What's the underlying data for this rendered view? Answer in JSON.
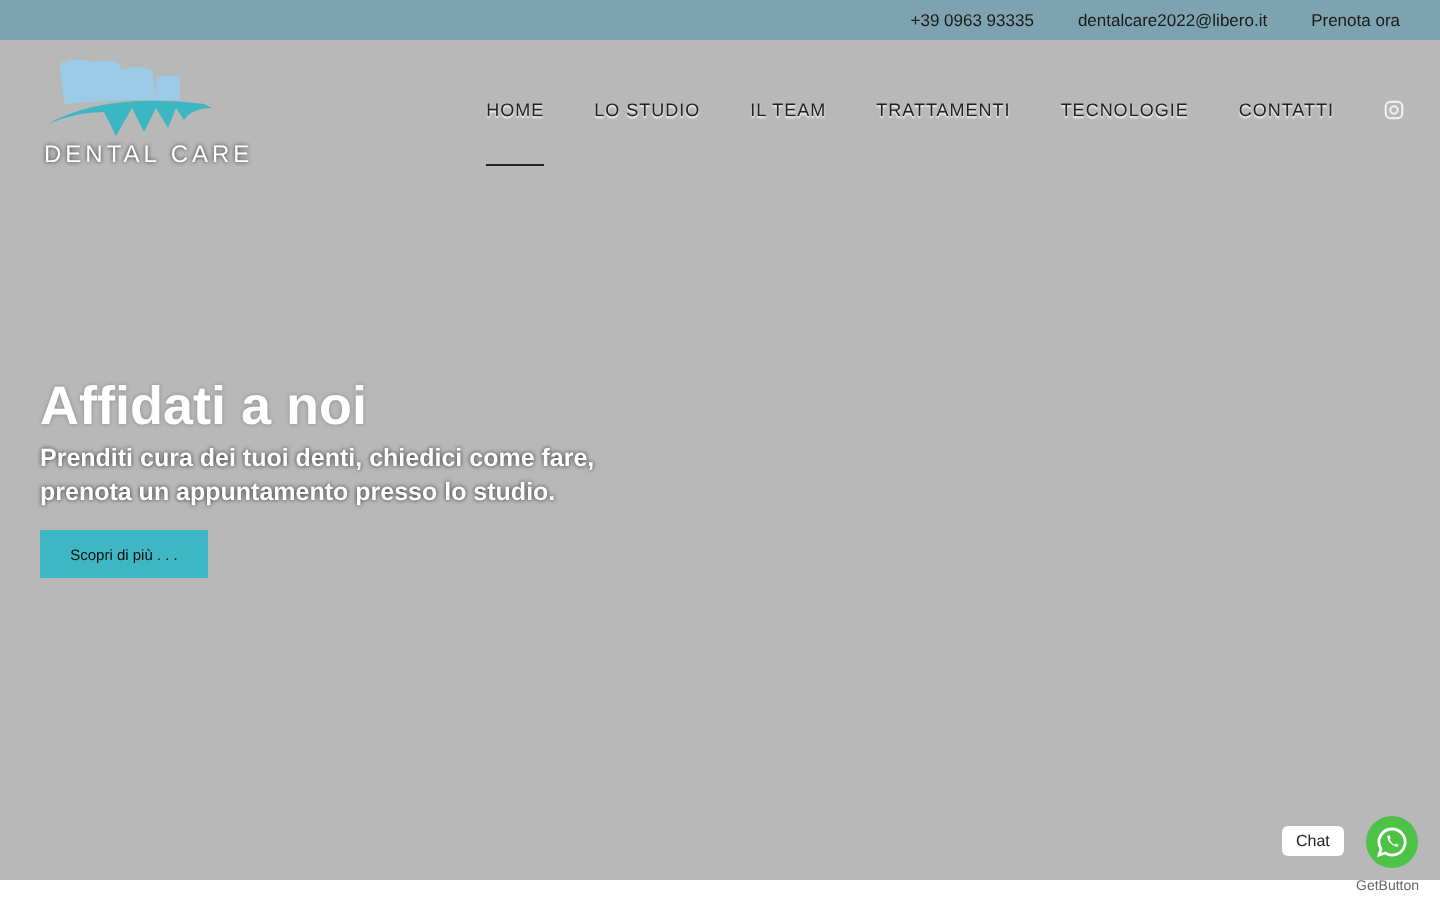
{
  "topbar": {
    "links": [
      "+39 0963 93335",
      "dentalcare2022@libero.it",
      "Prenota ora"
    ]
  },
  "logo": {
    "text": "DENTAL CARE"
  },
  "nav": {
    "items": [
      {
        "label": "HOME",
        "selected": true
      },
      {
        "label": "LO STUDIO",
        "selected": false
      },
      {
        "label": "IL TEAM",
        "selected": false
      },
      {
        "label": "TRATTAMENTI",
        "selected": false
      },
      {
        "label": "TECNOLOGIE",
        "selected": false
      },
      {
        "label": "CONTATTI",
        "selected": false
      }
    ]
  },
  "hero": {
    "title": "Affidati a noi",
    "subtitle": "Prenditi cura dei tuoi denti, chiedici come fare,\nprenota un appuntamento presso lo studio.",
    "button": "Scopri di più . . ."
  },
  "chat": {
    "label": "Chat",
    "credit": "GetButton"
  }
}
